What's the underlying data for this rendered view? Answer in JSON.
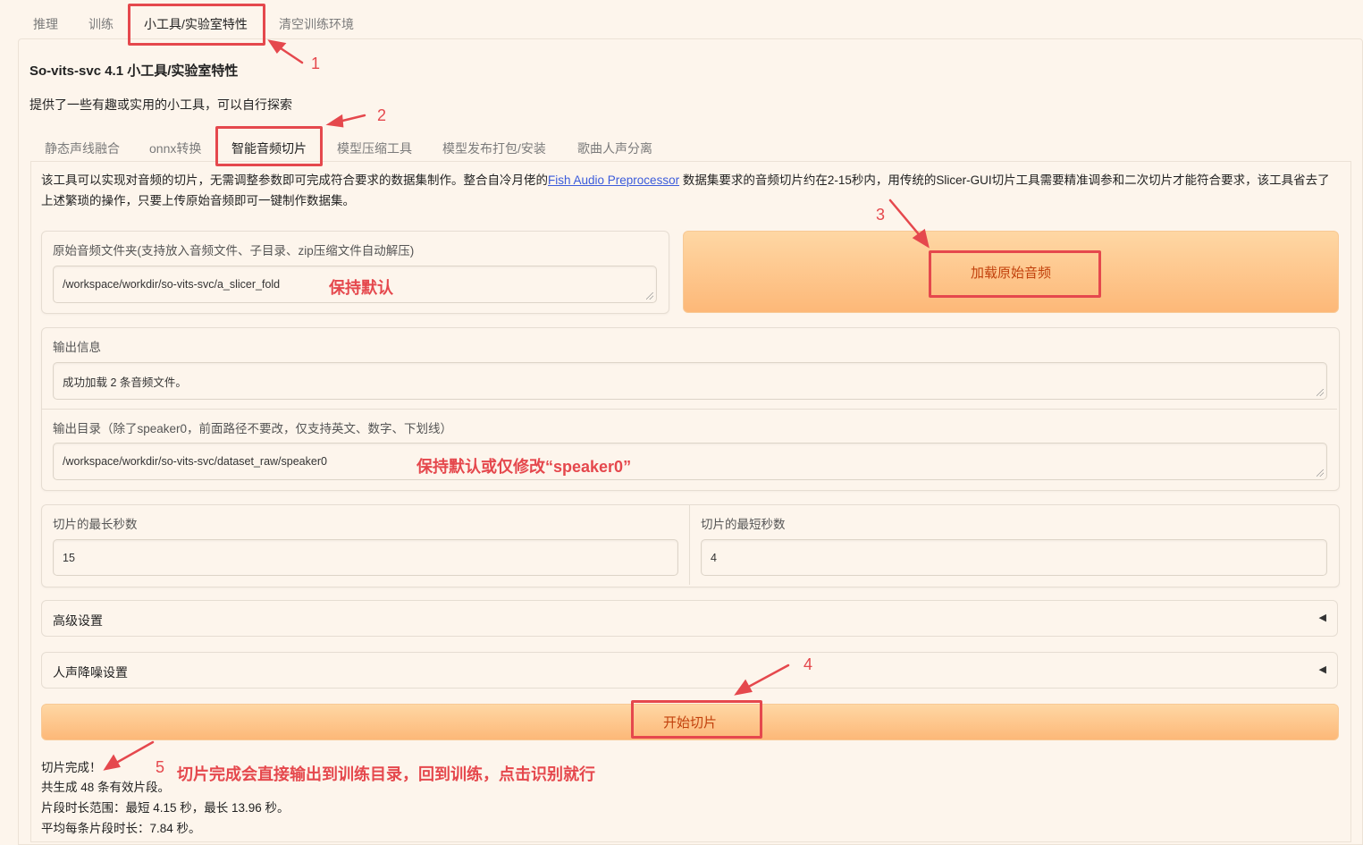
{
  "top_tabs": [
    "推理",
    "训练",
    "小工具/实验室特性",
    "清空训练环境"
  ],
  "page_title": "So-vits-svc 4.1 小工具/实验室特性",
  "page_desc": "提供了一些有趣或实用的小工具，可以自行探索",
  "sub_tabs": [
    "静态声线融合",
    "onnx转换",
    "智能音频切片",
    "模型压缩工具",
    "模型发布打包/安装",
    "歌曲人声分离"
  ],
  "intro": {
    "part1": "该工具可以实现对音频的切片，无需调整参数即可完成符合要求的数据集制作。整合自冷月佬的",
    "link": "Fish Audio Preprocessor",
    "part2": " 数据集要求的音频切片约在2-15秒内，用传统的Slicer-GUI切片工具需要精准调参和二次切片才能符合要求，该工具省去了上述繁琐的操作，只要上传原始音频即可一键制作数据集。"
  },
  "input_folder": {
    "label": "原始音频文件夹(支持放入音频文件、子目录、zip压缩文件自动解压)",
    "value": "/workspace/workdir/so-vits-svc/a_slicer_fold"
  },
  "load_button": "加载原始音频",
  "output_info": {
    "label": "输出信息",
    "value": "成功加载 2 条音频文件。"
  },
  "output_dir": {
    "label": "输出目录（除了speaker0，前面路径不要改，仅支持英文、数字、下划线）",
    "value": "/workspace/workdir/so-vits-svc/dataset_raw/speaker0"
  },
  "max_seconds": {
    "label": "切片的最长秒数",
    "value": "15"
  },
  "min_seconds": {
    "label": "切片的最短秒数",
    "value": "4"
  },
  "advanced_settings": "高级设置",
  "denoise_settings": "人声降噪设置",
  "start_button": "开始切片",
  "results": [
    "切片完成！",
    "共生成 48 条有效片段。",
    "片段时长范围：最短 4.15 秒，最长 13.96 秒。",
    "平均每条片段时长：7.84 秒。"
  ],
  "annotations": {
    "n1": "1",
    "n2": "2",
    "n3": "3",
    "n4": "4",
    "n5": "5",
    "keep_default": "保持默认",
    "keep_default_or_modify": "保持默认或仅修改“speaker0”",
    "done_note": "切片完成会直接输出到训练目录，回到训练，点击识别就行"
  },
  "colors": {
    "accent": "#e5484d",
    "button_text": "#c2410c",
    "link": "#3b5bdb"
  }
}
